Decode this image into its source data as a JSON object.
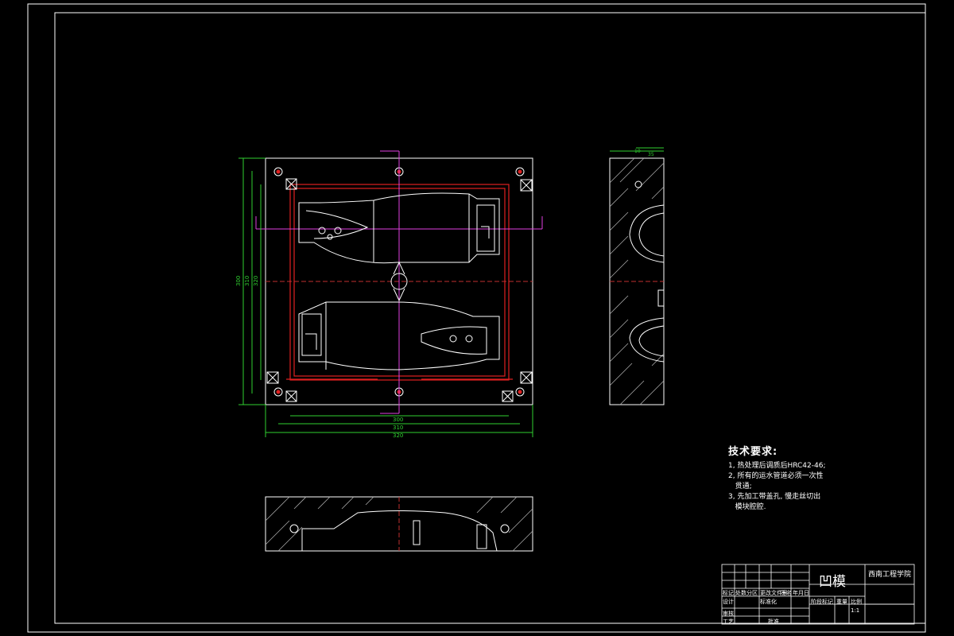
{
  "drawing": {
    "dimensions_left": [
      "300",
      "310",
      "320"
    ],
    "dimensions_bottom": [
      "300",
      "310",
      "320"
    ],
    "side_dims_top": [
      "35",
      "10"
    ]
  },
  "tech_notes": {
    "heading": "技术要求:",
    "items": [
      "1, 热处理后调质后HRC42-46;",
      "2, 所有的运水管道必须一次性",
      "   贯通;",
      "3, 先加工带盖孔, 慢走丝切出",
      "   模块腔腔."
    ]
  },
  "title_block": {
    "drawing_title": "凹模",
    "school": "西南工程学院",
    "row_labels": [
      "标记",
      "处数",
      "分区",
      "更改文件号",
      "签名",
      "年月日"
    ],
    "labels": {
      "design": "设计",
      "standardize": "标准化",
      "review": "审核",
      "process": "工艺",
      "approve": "批准",
      "stage_mark": "阶段标记",
      "weight": "重量",
      "scale": "比例",
      "scale_value": "1:1"
    }
  }
}
